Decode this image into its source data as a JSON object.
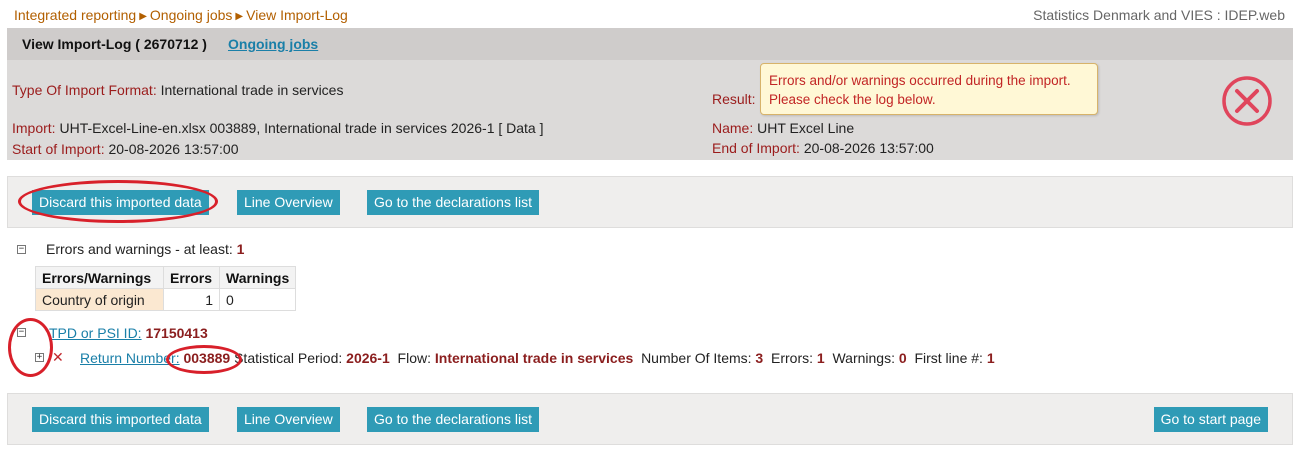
{
  "breadcrumb": {
    "items": [
      "Integrated reporting",
      "Ongoing jobs",
      "View Import-Log"
    ],
    "separator": "▶"
  },
  "site_title": "Statistics Denmark and VIES : IDEP.web",
  "header": {
    "title": "View Import-Log ( 2670712 )",
    "ongoing_link": "Ongoing jobs"
  },
  "info": {
    "type_label": "Type Of Import Format:",
    "type_value": "International trade in services",
    "import_label": "Import:",
    "import_value": "UHT-Excel-Line-en.xlsx 003889, International trade in services 2026-1 [ Data ]",
    "start_label": "Start of Import:",
    "start_value": "20-08-2026 13:57:00",
    "result_label": "Result:",
    "name_label": "Name:",
    "name_value": "UHT Excel Line",
    "end_label": "End of Import:",
    "end_value": "20-08-2026 13:57:00"
  },
  "alert": {
    "line1": "Errors and/or warnings occurred during the import.",
    "line2": "Please check the log below."
  },
  "buttons": {
    "discard": "Discard this imported data",
    "line_overview": "Line Overview",
    "declarations": "Go to the declarations list",
    "start_page": "Go to start page"
  },
  "errors_section": {
    "label": "Errors and warnings - at least:",
    "count": "1",
    "table": {
      "headers": [
        "Errors/Warnings",
        "Errors",
        "Warnings"
      ],
      "rows": [
        {
          "category": "Country of origin",
          "errors": "1",
          "warnings": "0"
        }
      ]
    }
  },
  "tpd": {
    "label": "TPD or PSI ID:",
    "value": "17150413"
  },
  "return": {
    "label": "Return Number:",
    "number": "003889",
    "period_label": "Statistical Period:",
    "period_value": "2026-1",
    "flow_label": "Flow:",
    "flow_value": "International trade in services",
    "items_label": "Number Of Items:",
    "items_value": "3",
    "errors_label": "Errors:",
    "errors_value": "1",
    "warnings_label": "Warnings:",
    "warnings_value": "0",
    "firstline_label": "First line #:",
    "firstline_value": "1"
  },
  "colors": {
    "accent": "#2f9bb6",
    "error": "#c22525",
    "label": "#9b1c1c",
    "breadcrumb": "#b25f00",
    "annotation": "#d8202a"
  },
  "icons": {
    "result": "error-circle-x-icon",
    "collapse": "minus-box-icon",
    "expand": "plus-box-icon",
    "row_error": "red-x-icon"
  }
}
